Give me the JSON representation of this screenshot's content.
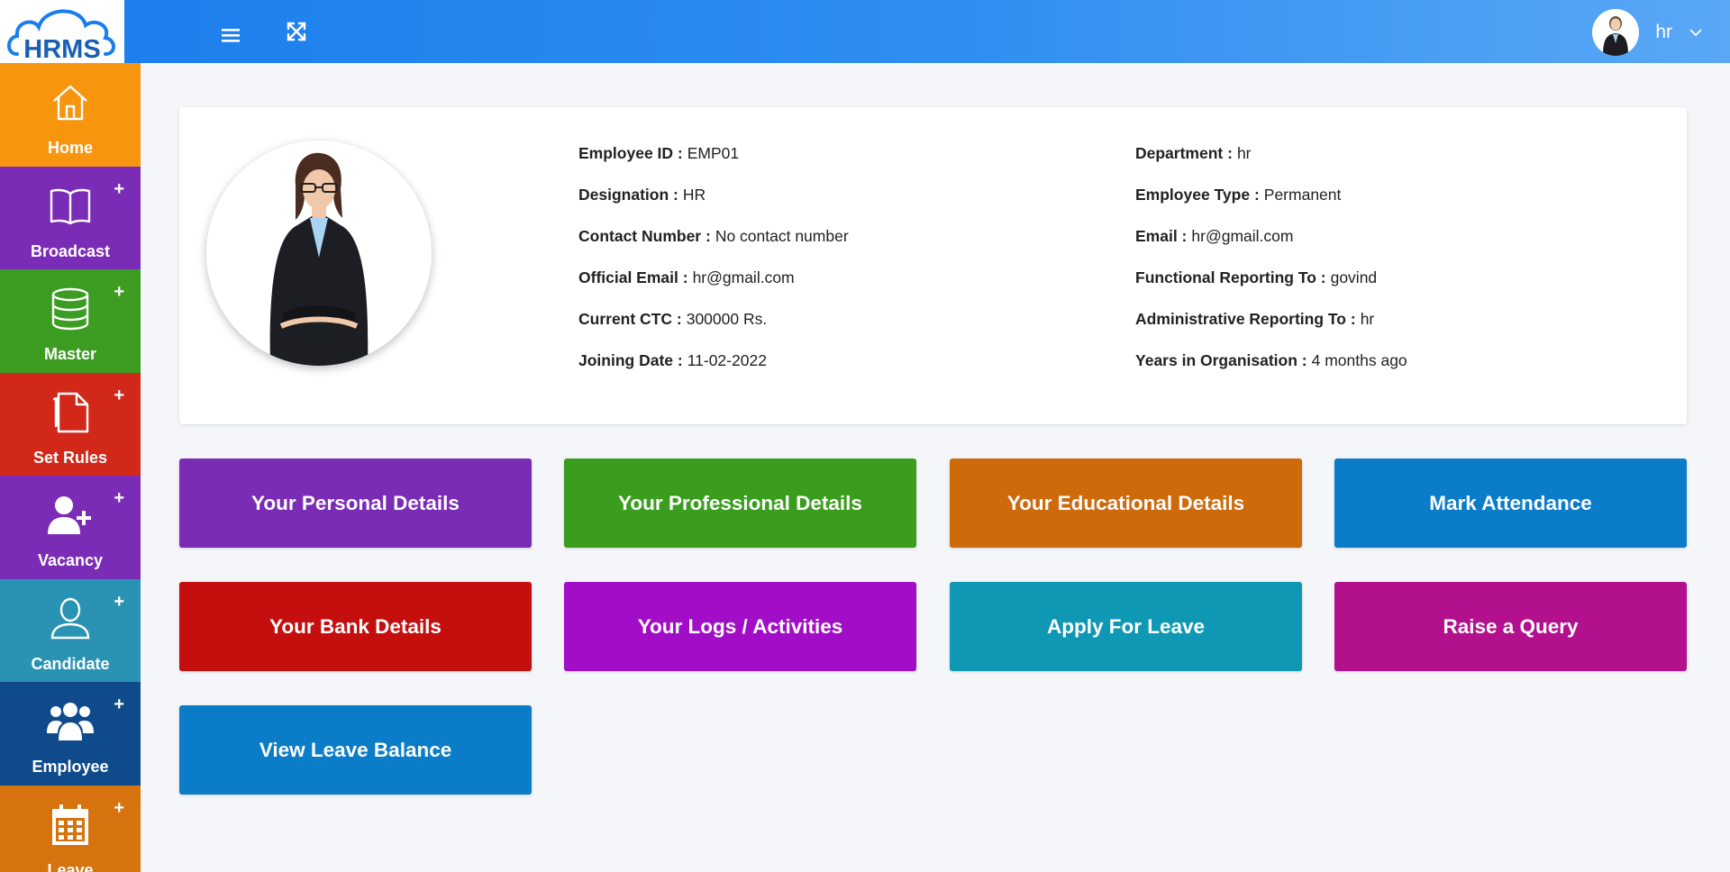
{
  "app": {
    "logo_text": "HRMS"
  },
  "topbar": {
    "user_name": "hr"
  },
  "sidebar": {
    "items": [
      {
        "label": "Home",
        "icon": "home-icon",
        "color": "#f7960e",
        "has_plus": false
      },
      {
        "label": "Broadcast",
        "icon": "book-icon",
        "color": "#7a2cb6",
        "has_plus": true
      },
      {
        "label": "Master",
        "icon": "database-icon",
        "color": "#3c9d22",
        "has_plus": true
      },
      {
        "label": "Set Rules",
        "icon": "document-pen-icon",
        "color": "#d1281a",
        "has_plus": true
      },
      {
        "label": "Vacancy",
        "icon": "user-plus-icon",
        "color": "#7a2cb6",
        "has_plus": true
      },
      {
        "label": "Candidate",
        "icon": "user-outline-icon",
        "color": "#2a93b4",
        "has_plus": true
      },
      {
        "label": "Employee",
        "icon": "users-icon",
        "color": "#0f4a8a",
        "has_plus": true
      },
      {
        "label": "Leave",
        "icon": "calendar-icon",
        "color": "#d6730f",
        "has_plus": true
      }
    ]
  },
  "profile": {
    "left": [
      {
        "key": "Employee ID :",
        "value": "EMP01"
      },
      {
        "key": "Designation :",
        "value": "HR"
      },
      {
        "key": "Contact Number :",
        "value": "No contact number"
      },
      {
        "key": "Official Email :",
        "value": "hr@gmail.com"
      },
      {
        "key": "Current CTC :",
        "value": "300000 Rs."
      },
      {
        "key": "Joining Date :",
        "value": "11-02-2022"
      }
    ],
    "right": [
      {
        "key": "Department :",
        "value": "hr"
      },
      {
        "key": "Employee Type :",
        "value": "Permanent"
      },
      {
        "key": "Email :",
        "value": "hr@gmail.com"
      },
      {
        "key": "Functional Reporting To :",
        "value": "govind"
      },
      {
        "key": "Administrative Reporting To :",
        "value": "hr"
      },
      {
        "key": "Years in Organisation :",
        "value": "4 months ago"
      }
    ]
  },
  "tiles": [
    {
      "label": "Your Personal Details",
      "color": "#7a2cb6"
    },
    {
      "label": "Your Professional Details",
      "color": "#3a9d1e"
    },
    {
      "label": "Your Educational Details",
      "color": "#cc6a0c"
    },
    {
      "label": "Mark Attendance",
      "color": "#0b7cc7"
    },
    {
      "label": "Your Bank Details",
      "color": "#c50e0e"
    },
    {
      "label": "Your Logs / Activities",
      "color": "#a20ec7"
    },
    {
      "label": "Apply For Leave",
      "color": "#0e98b3"
    },
    {
      "label": "Raise a Query",
      "color": "#b3108d"
    },
    {
      "label": "View Leave Balance",
      "color": "#0b7cc7"
    }
  ]
}
